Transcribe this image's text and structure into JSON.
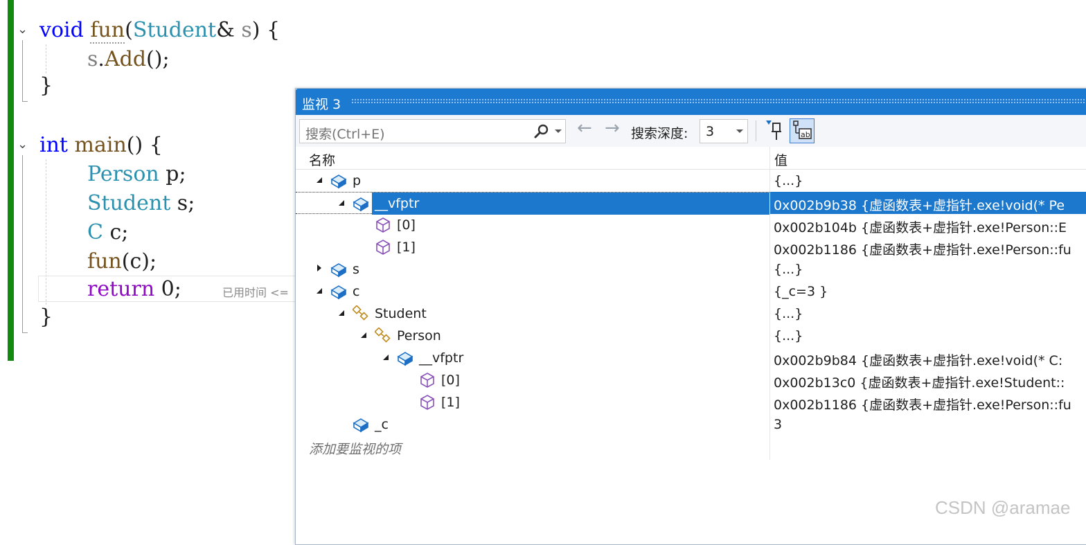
{
  "editor": {
    "lines": [
      {
        "parts": [
          {
            "t": "void",
            "c": "kw"
          },
          {
            "t": " "
          },
          {
            "t": "fun",
            "c": "fn fun-under"
          },
          {
            "t": "("
          },
          {
            "t": "Student",
            "c": "ty"
          },
          {
            "t": "& "
          },
          {
            "t": "s",
            "c": "pm"
          },
          {
            "t": ") {"
          }
        ]
      },
      {
        "parts": [
          {
            "t": "s",
            "c": "pm"
          },
          {
            "t": "."
          },
          {
            "t": "Add",
            "c": "fn"
          },
          {
            "t": "();"
          }
        ]
      },
      {
        "parts": [
          {
            "t": "}"
          }
        ]
      },
      {
        "parts": [
          {
            "t": "int",
            "c": "kw"
          },
          {
            "t": " "
          },
          {
            "t": "main",
            "c": "fn"
          },
          {
            "t": "() {"
          }
        ]
      },
      {
        "parts": [
          {
            "t": "Person",
            "c": "ty"
          },
          {
            "t": " p;"
          }
        ]
      },
      {
        "parts": [
          {
            "t": "Student",
            "c": "ty"
          },
          {
            "t": " s;"
          }
        ]
      },
      {
        "parts": [
          {
            "t": "C",
            "c": "ty"
          },
          {
            "t": " c;"
          }
        ]
      },
      {
        "parts": [
          {
            "t": "fun",
            "c": "fn"
          },
          {
            "t": "(c);"
          }
        ]
      },
      {
        "parts": [
          {
            "t": "return",
            "c": "ct"
          },
          {
            "t": " 0;"
          }
        ]
      },
      {
        "parts": [
          {
            "t": "}"
          }
        ]
      }
    ],
    "elapsed_hint": "已用时间 <="
  },
  "watch": {
    "title": "监视 3",
    "search_placeholder": "搜索(Ctrl+E)",
    "depth_label": "搜索深度:",
    "depth_value": "3",
    "col_name": "名称",
    "col_value": "值",
    "add_item": "添加要监视的项",
    "rows": [
      {
        "name": "p",
        "value": "{...}",
        "expand": "open",
        "icon": "variable-icon"
      },
      {
        "name": "__vfptr",
        "value": "0x002b9b38 {虚函数表+虚指针.exe!void(* Pe",
        "expand": "open",
        "icon": "variable-icon",
        "selected": true
      },
      {
        "name": "[0]",
        "value": "0x002b104b {虚函数表+虚指针.exe!Person::E",
        "expand": "none",
        "icon": "field-icon"
      },
      {
        "name": "[1]",
        "value": "0x002b1186 {虚函数表+虚指针.exe!Person::fu",
        "expand": "none",
        "icon": "field-icon"
      },
      {
        "name": "s",
        "value": "{...}",
        "expand": "closed",
        "icon": "variable-icon"
      },
      {
        "name": "c",
        "value": "{_c=3 }",
        "expand": "open",
        "icon": "variable-icon"
      },
      {
        "name": "Student",
        "value": "{...}",
        "expand": "open",
        "icon": "base-class-icon"
      },
      {
        "name": "Person",
        "value": "{...}",
        "expand": "open",
        "icon": "base-class-icon"
      },
      {
        "name": "__vfptr",
        "value": "0x002b9b84 {虚函数表+虚指针.exe!void(* C:",
        "expand": "open",
        "icon": "variable-icon"
      },
      {
        "name": "[0]",
        "value": "0x002b13c0 {虚函数表+虚指针.exe!Student::",
        "expand": "none",
        "icon": "field-icon"
      },
      {
        "name": "[1]",
        "value": "0x002b1186 {虚函数表+虚指针.exe!Person::fu",
        "expand": "none",
        "icon": "field-icon"
      },
      {
        "name": "_c",
        "value": "3",
        "expand": "none",
        "icon": "variable-icon"
      }
    ]
  },
  "watermark": "CSDN @aramae"
}
